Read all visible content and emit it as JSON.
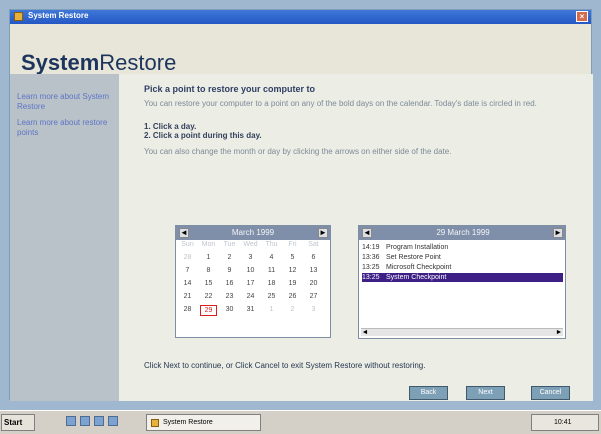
{
  "window": {
    "title": "System Restore",
    "close_label": "×"
  },
  "header": {
    "title_bold": "System",
    "title_rest": "Restore"
  },
  "sidebar": {
    "items": [
      {
        "label": "Learn more about System Restore"
      },
      {
        "label": "Learn more about restore points"
      }
    ]
  },
  "content": {
    "heading": "Pick a point to restore your computer to",
    "intro": "You can restore your computer to a point on any of the bold days on the calendar. Today's date is circled in red.",
    "steps": [
      "1. Click a day.",
      "2. Click a point during this day."
    ],
    "hint": "You can also change the month or day by clicking the arrows on either side of the date.",
    "footer": "Click Next to continue, or Click Cancel to exit System Restore without restoring."
  },
  "calendar": {
    "prev": "◄",
    "next": "►",
    "title": "March 1999",
    "dow": [
      "Sun",
      "Mon",
      "Tue",
      "Wed",
      "Thu",
      "Fri",
      "Sat"
    ],
    "weeks": [
      [
        "28",
        "1",
        "2",
        "3",
        "4",
        "5",
        "6"
      ],
      [
        "7",
        "8",
        "9",
        "10",
        "11",
        "12",
        "13"
      ],
      [
        "14",
        "15",
        "16",
        "17",
        "18",
        "19",
        "20"
      ],
      [
        "21",
        "22",
        "23",
        "24",
        "25",
        "26",
        "27"
      ],
      [
        "28",
        "29",
        "30",
        "31",
        "1",
        "2",
        "3"
      ]
    ],
    "today": "29",
    "accent": "#d71f1f"
  },
  "restore_list": {
    "prev": "◄",
    "next": "►",
    "title": "29 March 1999",
    "entries": [
      {
        "time": "14:19",
        "label": "Program Installation"
      },
      {
        "time": "13:36",
        "label": "Set Restore Point"
      },
      {
        "time": "13:25",
        "label": "Microsoft Checkpoint"
      },
      {
        "time": "13:25",
        "label": "System Checkpoint"
      }
    ],
    "selected_index": 3,
    "scroll_left": "◄",
    "scroll_right": "►"
  },
  "buttons": {
    "back": "Back",
    "next": "Next",
    "cancel": "Cancel"
  },
  "taskbar": {
    "start": "Start",
    "task": "System Restore",
    "clock": "10:41"
  }
}
